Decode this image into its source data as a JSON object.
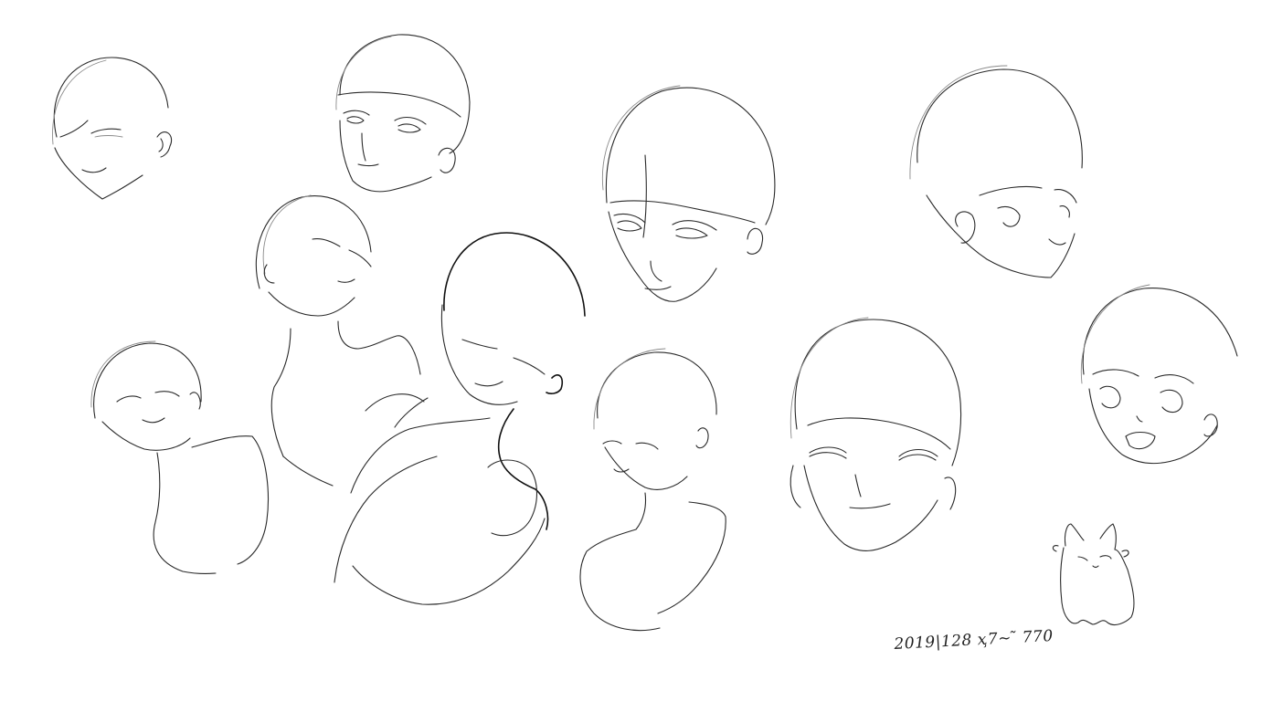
{
  "signature": {
    "text": "2019|128 ҳ7~ ̃ 770"
  },
  "sketches": [
    {
      "id": "head-1",
      "pose": "three-quarter down, eyes closed, smiling"
    },
    {
      "id": "head-2",
      "pose": "front-left, eyes open"
    },
    {
      "id": "head-3",
      "pose": "tilted up, eyes closed, with neck and shoulder"
    },
    {
      "id": "head-4",
      "pose": "front, eyes half-open, frowning"
    },
    {
      "id": "head-5",
      "pose": "profile right, looking down"
    },
    {
      "id": "bust-1",
      "pose": "eyes closed, smiling, head tilted"
    },
    {
      "id": "bust-2",
      "pose": "head tilted, eyes closed, hand at shoulder"
    },
    {
      "id": "bust-3",
      "pose": "looking down, eyes half closed"
    },
    {
      "id": "head-6",
      "pose": "front, eyes closed, smiling"
    },
    {
      "id": "head-7",
      "pose": "front, big eyes, open mouth"
    },
    {
      "id": "doodle-cat",
      "pose": "small ghost cat doodle"
    }
  ],
  "colors": {
    "background": "#ffffff",
    "ink": "#2a2a2a"
  }
}
